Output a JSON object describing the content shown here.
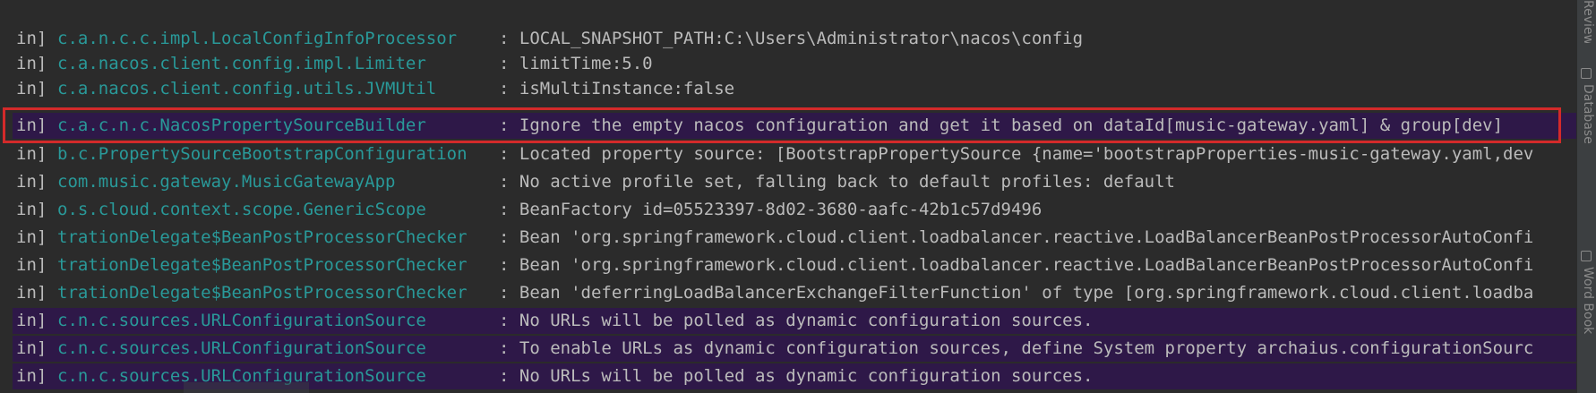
{
  "console": {
    "lines": [
      {
        "level": "in]",
        "logger": "c.a.n.c.c.impl.LocalConfigInfoProcessor",
        "message": ": LOCAL_SNAPSHOT_PATH:C:\\Users\\Administrator\\nacos\\config"
      },
      {
        "level": "in]",
        "logger": "c.a.nacos.client.config.impl.Limiter",
        "message": ": limitTime:5.0"
      },
      {
        "level": "in]",
        "logger": "c.a.nacos.client.config.utils.JVMUtil",
        "message": ": isMultiInstance:false"
      },
      {
        "level": "in]",
        "logger": "c.a.c.n.c.NacosPropertySourceBuilder",
        "message": ": Ignore the empty nacos configuration and get it based on dataId[music-gateway.yaml] & group[dev]"
      },
      {
        "level": "in]",
        "logger": "b.c.PropertySourceBootstrapConfiguration",
        "message": ": Located property source: [BootstrapPropertySource {name='bootstrapProperties-music-gateway.yaml,dev"
      },
      {
        "level": "in]",
        "logger": "com.music.gateway.MusicGatewayApp",
        "message": ": No active profile set, falling back to default profiles: default"
      },
      {
        "level": "in]",
        "logger": "o.s.cloud.context.scope.GenericScope",
        "message": ": BeanFactory id=05523397-8d02-3680-aafc-42b1c57d9496"
      },
      {
        "level": "in]",
        "logger": "trationDelegate$BeanPostProcessorChecker",
        "message": ": Bean 'org.springframework.cloud.client.loadbalancer.reactive.LoadBalancerBeanPostProcessorAutoConfi"
      },
      {
        "level": "in]",
        "logger": "trationDelegate$BeanPostProcessorChecker",
        "message": ": Bean 'org.springframework.cloud.client.loadbalancer.reactive.LoadBalancerBeanPostProcessorAutoConfi"
      },
      {
        "level": "in]",
        "logger": "trationDelegate$BeanPostProcessorChecker",
        "message": ": Bean 'deferringLoadBalancerExchangeFilterFunction' of type [org.springframework.cloud.client.loadba"
      },
      {
        "level": "in]",
        "logger": "c.n.c.sources.URLConfigurationSource",
        "message": ": No URLs will be polled as dynamic configuration sources."
      },
      {
        "level": "in]",
        "logger": "c.n.c.sources.URLConfigurationSource",
        "message": ": To enable URLs as dynamic configuration sources, define System property archaius.configurationSourc"
      },
      {
        "level": "in]",
        "logger": "c.n.c.sources.URLConfigurationSource",
        "message": ": No URLs will be polled as dynamic configuration sources."
      }
    ]
  },
  "right_sidebar": {
    "tabs": [
      "Review",
      "Database",
      "Word Book"
    ]
  },
  "colors": {
    "background": "#2b2b2b",
    "logger_name": "#299999",
    "text": "#bbbbbb",
    "selected_row": "#2e1848",
    "highlight_border": "#d32a2a"
  }
}
